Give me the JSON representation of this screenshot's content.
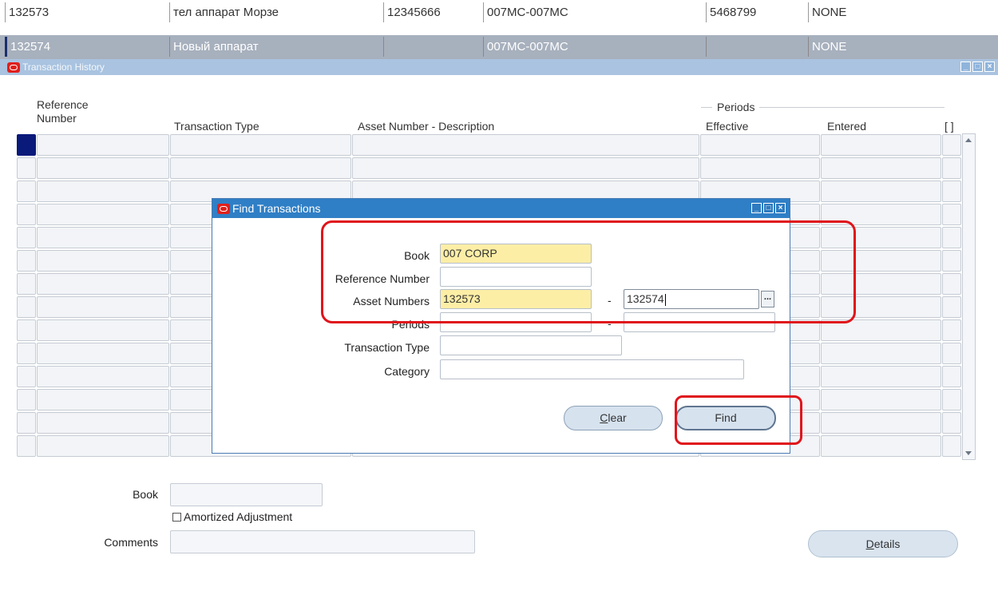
{
  "background_rows": [
    {
      "cells": [
        "132573",
        "тел аппарат Морзе",
        "12345666",
        "007MC-007MC",
        "5468799",
        "NONE"
      ],
      "selected": false
    },
    {
      "cells": [
        "132574",
        "Новый аппарат",
        "",
        "007MC-007MC",
        "",
        "NONE"
      ],
      "selected": true
    }
  ],
  "history_window": {
    "title": "Transaction History",
    "columns": {
      "ref_line1": "Reference",
      "ref_line2": "Number",
      "transaction_type": "Transaction Type",
      "asset_desc": "Asset Number - Description",
      "periods_group": "Periods",
      "effective": "Effective",
      "entered": "Entered",
      "bracket": "[ ]"
    },
    "book_label": "Book",
    "book_value": "",
    "amortized_label": "Amortized Adjustment",
    "comments_label": "Comments",
    "comments_value": "",
    "details_prefix": "D",
    "details_rest": "etails"
  },
  "find_dialog": {
    "title": "Find Transactions",
    "book_label": "Book",
    "book_value": "007 CORP",
    "ref_label": "Reference Number",
    "ref_value": "",
    "asset_label": "Asset Numbers",
    "asset_from": "132573",
    "asset_to": "132574",
    "asset_dash": "-",
    "periods_label": "Periods",
    "periods_dash": "-",
    "periods_from": "",
    "periods_to": "",
    "type_label": "Transaction Type",
    "type_value": "",
    "category_label": "Category",
    "category_value": "",
    "clear_prefix": "C",
    "clear_rest": "lear",
    "find_label": "Find",
    "lov_glyph": "..."
  },
  "colors": {
    "highlight": "#e0141b",
    "required_field": "#fdeea6",
    "dialog_title": "#2f7fc6",
    "selected_row": "#a7b0bd"
  }
}
